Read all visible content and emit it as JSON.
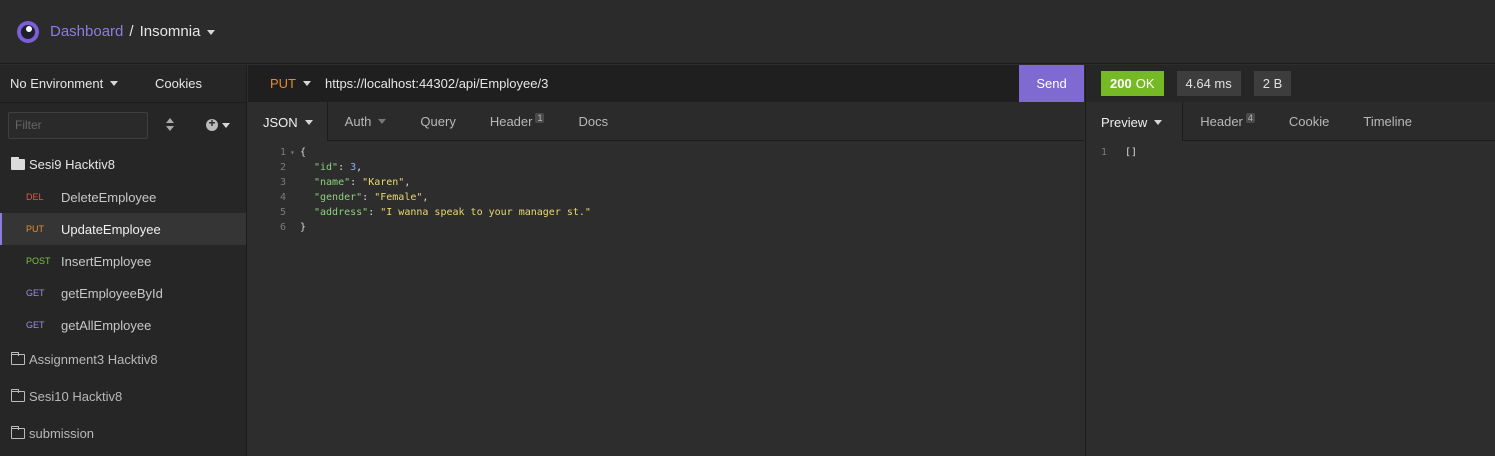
{
  "header": {
    "dashboard_label": "Dashboard",
    "separator": "/",
    "workspace_label": "Insomnia"
  },
  "sidebar": {
    "environment": "No Environment",
    "cookies": "Cookies",
    "filter_placeholder": "Filter",
    "open_folder": "Sesi9 Hacktiv8",
    "requests": [
      {
        "method": "DEL",
        "name": "DeleteEmployee"
      },
      {
        "method": "PUT",
        "name": "UpdateEmployee"
      },
      {
        "method": "POST",
        "name": "InsertEmployee"
      },
      {
        "method": "GET",
        "name": "getEmployeeById"
      },
      {
        "method": "GET",
        "name": "getAllEmployee"
      }
    ],
    "closed_folders": [
      "Assignment3 Hacktiv8",
      "Sesi10 Hacktiv8",
      "submission"
    ]
  },
  "request": {
    "method": "PUT",
    "url": "https://localhost:44302/api/Employee/3",
    "send_label": "Send",
    "tabs": {
      "json": "JSON",
      "auth": "Auth",
      "query": "Query",
      "header": "Header",
      "header_count": "1",
      "docs": "Docs"
    },
    "body": {
      "line_numbers": [
        "1",
        "2",
        "3",
        "4",
        "5",
        "6"
      ],
      "open_brace": "{",
      "close_brace": "}",
      "id_key": "\"id\"",
      "id_value": "3",
      "name_key": "\"name\"",
      "name_value": "\"Karen\"",
      "gender_key": "\"gender\"",
      "gender_value": "\"Female\"",
      "address_key": "\"address\"",
      "address_value": "\"I wanna speak to your manager st.\""
    }
  },
  "response": {
    "status_code": "200",
    "status_text": "OK",
    "time": "4.64 ms",
    "size": "2 B",
    "tabs": {
      "preview": "Preview",
      "header": "Header",
      "header_count": "4",
      "cookie": "Cookie",
      "timeline": "Timeline"
    },
    "body": {
      "line_number": "1",
      "content": "[]"
    }
  },
  "colors": {
    "accent": "#7e6ad1",
    "status_ok": "#75ba24",
    "method_put": "#e88a2c",
    "method_del": "#e05a3c",
    "method_post": "#7bc142",
    "method_get": "#9f8bea"
  }
}
